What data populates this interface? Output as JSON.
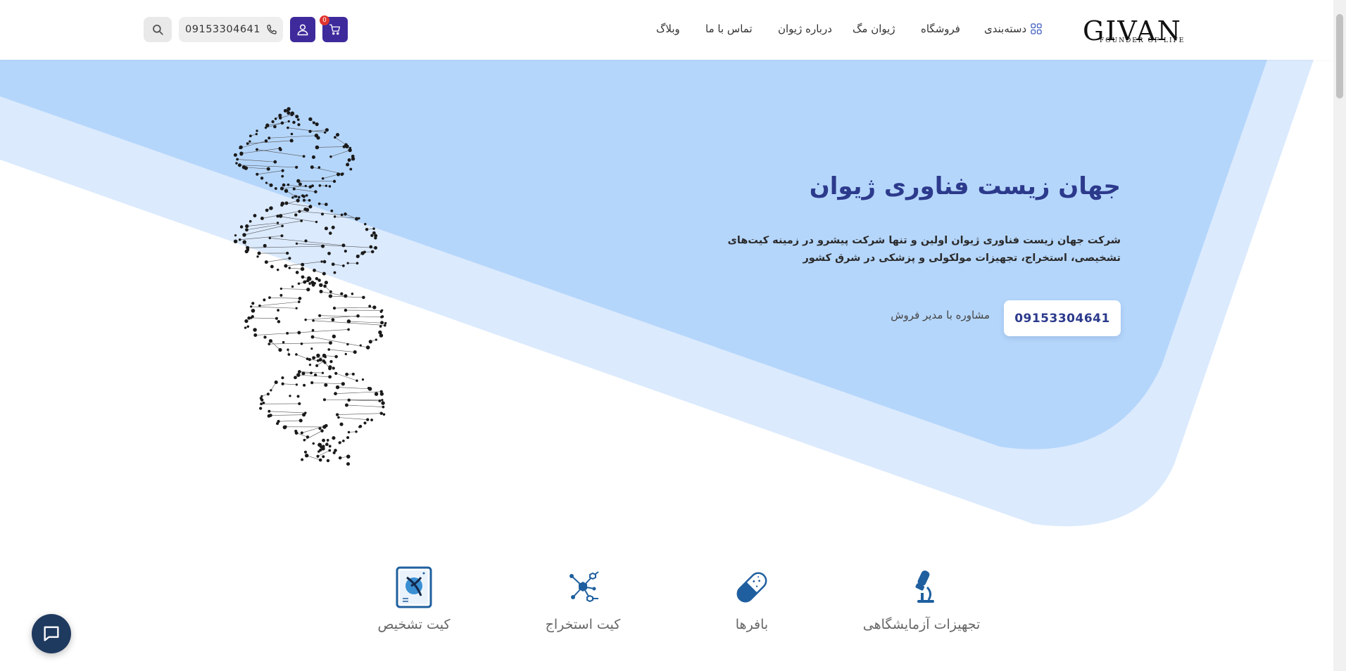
{
  "brand": {
    "logo_text": "GIVAN",
    "logo_tagline": "FOUNDER OF LIFE"
  },
  "nav": {
    "categories": "دسته‌بندی",
    "shop": "فروشگاه",
    "mag": "ژیوان مگ",
    "about": "درباره ژیوان",
    "contact": "تماس با ما",
    "blog": "وبلاگ"
  },
  "header_actions": {
    "cart_count": "0",
    "phone": "09153304641",
    "search_icon": "search-icon",
    "cart_icon": "cart-icon",
    "user_icon": "user-icon",
    "phone_icon": "phone-icon"
  },
  "hero": {
    "title": "جهان زیست فناوری ژیوان",
    "description": "شرکت جهان زیست فناوری ژیوان اولین و تنها شرکت پیشرو در زمینه کیت‌های تشخیصی، استخراج، تجهیزات مولکولی و پزشکی در شرق کشور",
    "cta_phone": "09153304641",
    "cta_label": "مشاوره با مدیر فروش"
  },
  "categories": [
    {
      "label": "تجهیزات آزمایشگاهی",
      "icon": "microscope-icon"
    },
    {
      "label": "بافرها",
      "icon": "capsule-icon"
    },
    {
      "label": "کیت استخراج",
      "icon": "molecule-icon"
    },
    {
      "label": "کیت تشخیص",
      "icon": "test-kit-icon"
    }
  ],
  "colors": {
    "primary": "#3f2a9c",
    "title": "#2c3a8c",
    "hero_light": "#dbeafd",
    "hero_mid": "#b5d6fb",
    "icon_blue": "#1f5f9f",
    "chat": "#1f3a5f",
    "badge": "#e0342f"
  }
}
